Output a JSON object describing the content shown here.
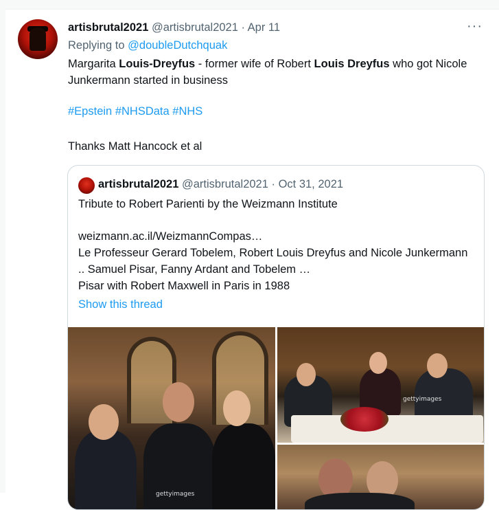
{
  "tweet": {
    "display_name": "artisbrutal2021",
    "handle": "@artisbrutal2021",
    "separator": " · ",
    "date": "Apr 11",
    "more_label": "···",
    "replying_prefix": "Replying to ",
    "replying_to": "@doubleDutchquak",
    "body_parts": {
      "p1": "Margarita ",
      "b1": "Louis-Dreyfus",
      "p2": "  - former wife of Robert ",
      "b2": "Louis Dreyfus",
      "p3": " who got Nicole Junkermann started in business"
    },
    "hashtags": [
      "#Epstein",
      "#NHSData",
      "#NHS"
    ],
    "thanks": "Thanks Matt Hancock et al"
  },
  "quote": {
    "display_name": "artisbrutal2021",
    "handle": "@artisbrutal2021",
    "separator": " · ",
    "date": "Oct 31, 2021",
    "text": "Tribute to Robert Parienti by the Weizmann Institute",
    "link": "weizmann.ac.il/WeizmannCompas…",
    "line1": "Le Professeur Gerard Tobelem, Robert Louis Dreyfus and Nicole Junkermann .. Samuel Pisar, Fanny Ardant and Tobelem …",
    "line2": "Pisar with  Robert Maxwell in Paris in 1988",
    "show_thread": "Show this thread",
    "watermark1": "gettyimages",
    "watermark2": "gettyimages"
  }
}
